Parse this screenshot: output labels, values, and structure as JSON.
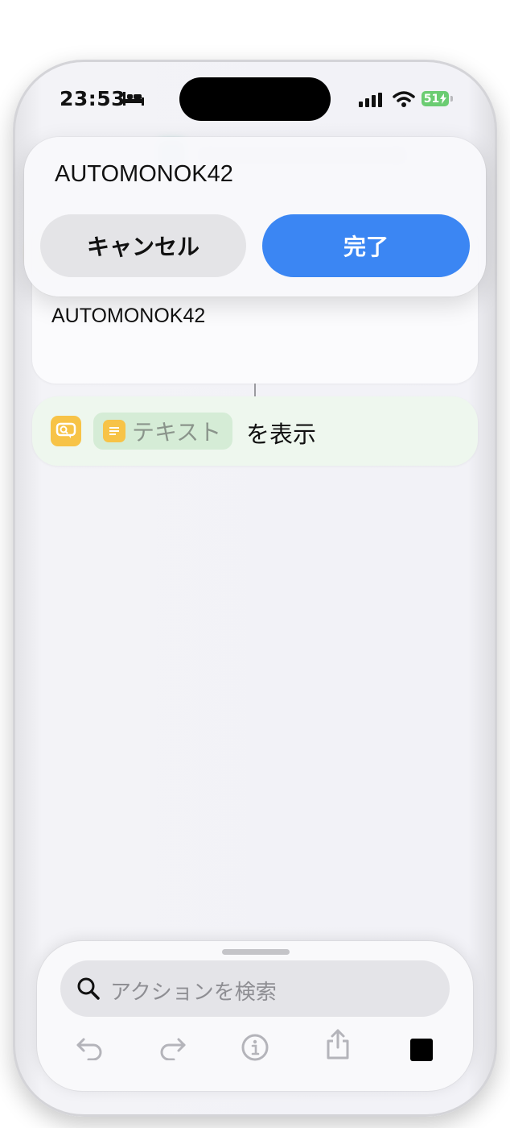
{
  "status_bar": {
    "time": "23:53",
    "battery": "51"
  },
  "popup": {
    "field_value": "AUTOMONOK42",
    "cancel_label": "キャンセル",
    "done_label": "完了"
  },
  "text_action": {
    "value": "AUTOMONOK42"
  },
  "show_action": {
    "variable_label": "テキスト",
    "suffix": "を表示"
  },
  "bottom_sheet": {
    "search_placeholder": "アクションを検索"
  },
  "colors": {
    "accent": "#3b86f3",
    "action_icon": "#f7c347",
    "show_action_bg": "#eef7ee",
    "battery": "#6bcc72"
  },
  "icons": [
    "bed-icon",
    "cellular-signal-icon",
    "wifi-icon",
    "battery-icon",
    "chat-bubble-icon",
    "text-icon",
    "search-icon",
    "undo-icon",
    "redo-icon",
    "info-icon",
    "share-icon",
    "stop-icon"
  ]
}
